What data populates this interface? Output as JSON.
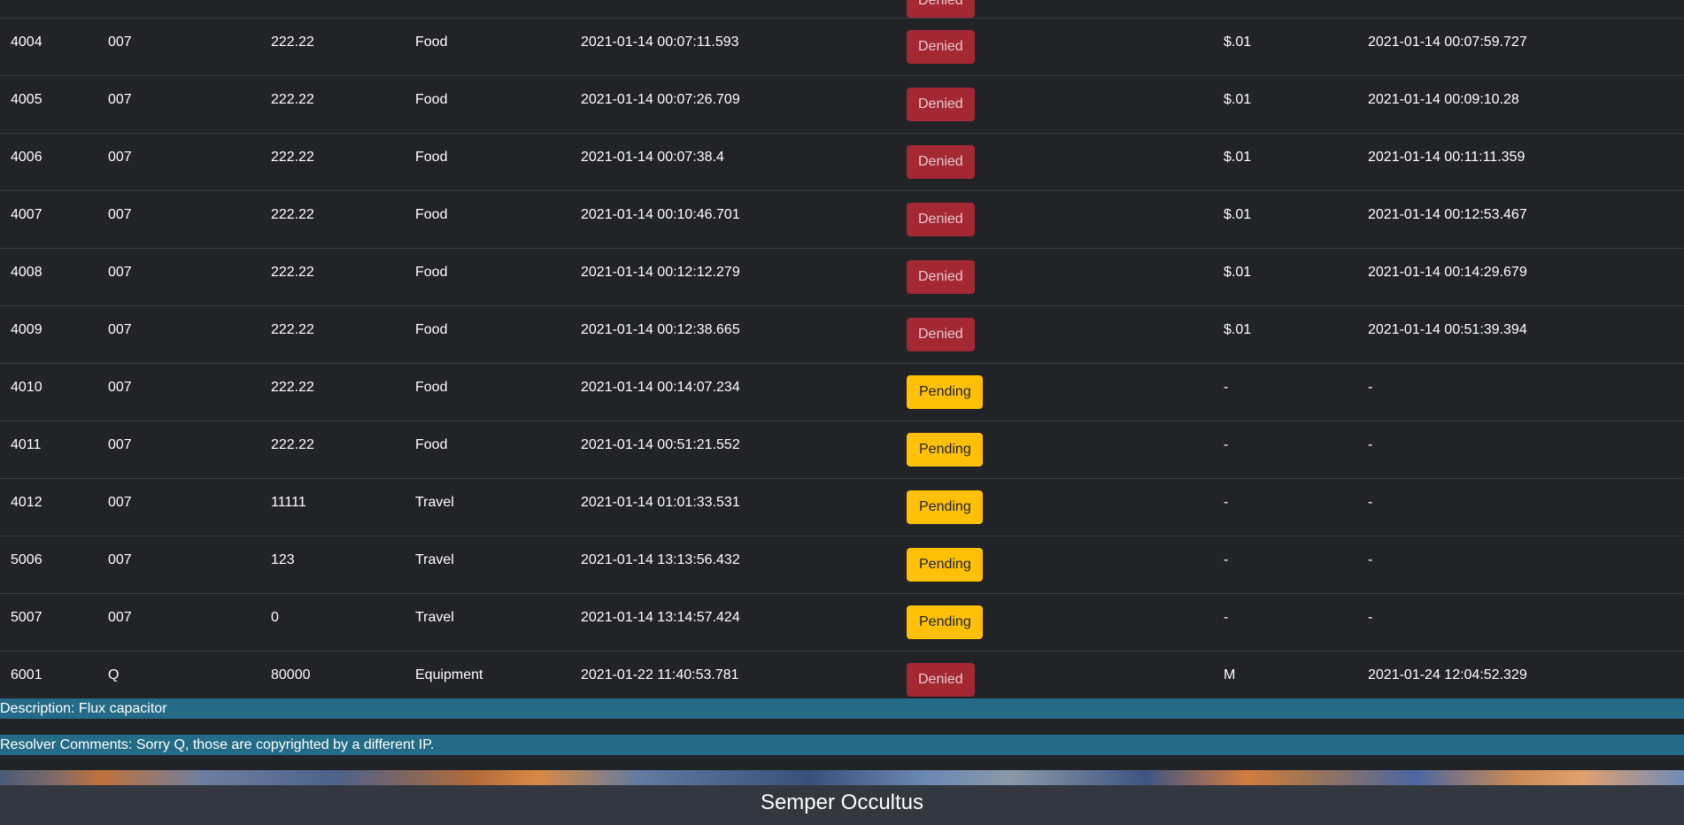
{
  "rows": [
    {
      "id": "",
      "employee": "",
      "amount": "",
      "type": "",
      "submitted": "",
      "status": "Denied",
      "status_kind": "denied",
      "resolver": "",
      "resolved": ""
    },
    {
      "id": "4004",
      "employee": "007",
      "amount": "222.22",
      "type": "Food",
      "submitted": "2021-01-14 00:07:11.593",
      "status": "Denied",
      "status_kind": "denied",
      "resolver": "$.01",
      "resolved": "2021-01-14 00:07:59.727"
    },
    {
      "id": "4005",
      "employee": "007",
      "amount": "222.22",
      "type": "Food",
      "submitted": "2021-01-14 00:07:26.709",
      "status": "Denied",
      "status_kind": "denied",
      "resolver": "$.01",
      "resolved": "2021-01-14 00:09:10.28"
    },
    {
      "id": "4006",
      "employee": "007",
      "amount": "222.22",
      "type": "Food",
      "submitted": "2021-01-14 00:07:38.4",
      "status": "Denied",
      "status_kind": "denied",
      "resolver": "$.01",
      "resolved": "2021-01-14 00:11:11.359"
    },
    {
      "id": "4007",
      "employee": "007",
      "amount": "222.22",
      "type": "Food",
      "submitted": "2021-01-14 00:10:46.701",
      "status": "Denied",
      "status_kind": "denied",
      "resolver": "$.01",
      "resolved": "2021-01-14 00:12:53.467"
    },
    {
      "id": "4008",
      "employee": "007",
      "amount": "222.22",
      "type": "Food",
      "submitted": "2021-01-14 00:12:12.279",
      "status": "Denied",
      "status_kind": "denied",
      "resolver": "$.01",
      "resolved": "2021-01-14 00:14:29.679"
    },
    {
      "id": "4009",
      "employee": "007",
      "amount": "222.22",
      "type": "Food",
      "submitted": "2021-01-14 00:12:38.665",
      "status": "Denied",
      "status_kind": "denied",
      "resolver": "$.01",
      "resolved": "2021-01-14 00:51:39.394"
    },
    {
      "id": "4010",
      "employee": "007",
      "amount": "222.22",
      "type": "Food",
      "submitted": "2021-01-14 00:14:07.234",
      "status": "Pending",
      "status_kind": "pending",
      "resolver": "-",
      "resolved": "-"
    },
    {
      "id": "4011",
      "employee": "007",
      "amount": "222.22",
      "type": "Food",
      "submitted": "2021-01-14 00:51:21.552",
      "status": "Pending",
      "status_kind": "pending",
      "resolver": "-",
      "resolved": "-"
    },
    {
      "id": "4012",
      "employee": "007",
      "amount": "11111",
      "type": "Travel",
      "submitted": "2021-01-14 01:01:33.531",
      "status": "Pending",
      "status_kind": "pending",
      "resolver": "-",
      "resolved": "-"
    },
    {
      "id": "5006",
      "employee": "007",
      "amount": "123",
      "type": "Travel",
      "submitted": "2021-01-14 13:13:56.432",
      "status": "Pending",
      "status_kind": "pending",
      "resolver": "-",
      "resolved": "-"
    },
    {
      "id": "5007",
      "employee": "007",
      "amount": "0",
      "type": "Travel",
      "submitted": "2021-01-14 13:14:57.424",
      "status": "Pending",
      "status_kind": "pending",
      "resolver": "-",
      "resolved": "-"
    },
    {
      "id": "6001",
      "employee": "Q",
      "amount": "80000",
      "type": "Equipment",
      "submitted": "2021-01-22 11:40:53.781",
      "status": "Denied",
      "status_kind": "denied",
      "resolver": "M",
      "resolved": "2021-01-24 12:04:52.329"
    }
  ],
  "details": {
    "description": "Description: Flux capacitor",
    "resolver_comments": "Resolver Comments: Sorry Q, those are copyrighted by a different IP."
  },
  "footer": {
    "motto": "Semper Occultus"
  },
  "colors": {
    "background": "#212327",
    "denied": "#a42834",
    "pending": "#ffc107",
    "info_bar": "#236b86",
    "footer": "#333740"
  }
}
